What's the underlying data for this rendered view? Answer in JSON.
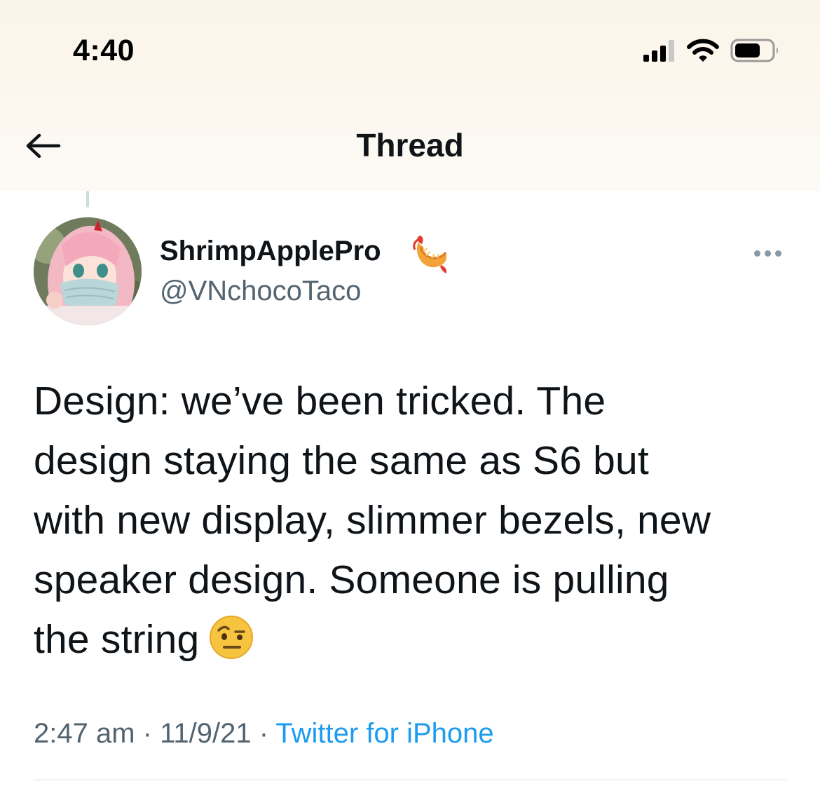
{
  "status_bar": {
    "time": "4:40"
  },
  "nav": {
    "title": "Thread",
    "back_icon": "arrow-left-icon"
  },
  "tweet": {
    "author": {
      "display_name": "ShrimpApplePro",
      "name_emoji": "shrimp-emoji-icon",
      "handle": "@VNchocoTaco"
    },
    "text_lines": [
      "Design: we’ve been tricked. The",
      "design staying the same as S6 but",
      "with new display, slimmer bezels, new",
      "speaker design. Someone is pulling",
      "the string"
    ],
    "inline_emoji": "raised-eyebrow-face-icon",
    "time": "2:47 am",
    "separator": " · ",
    "date": "11/9/21",
    "source": "Twitter for iPhone"
  },
  "colors": {
    "text_primary": "#0f1419",
    "text_secondary": "#536471",
    "link": "#1d9bf0",
    "top_background": "#fbf4e8"
  }
}
